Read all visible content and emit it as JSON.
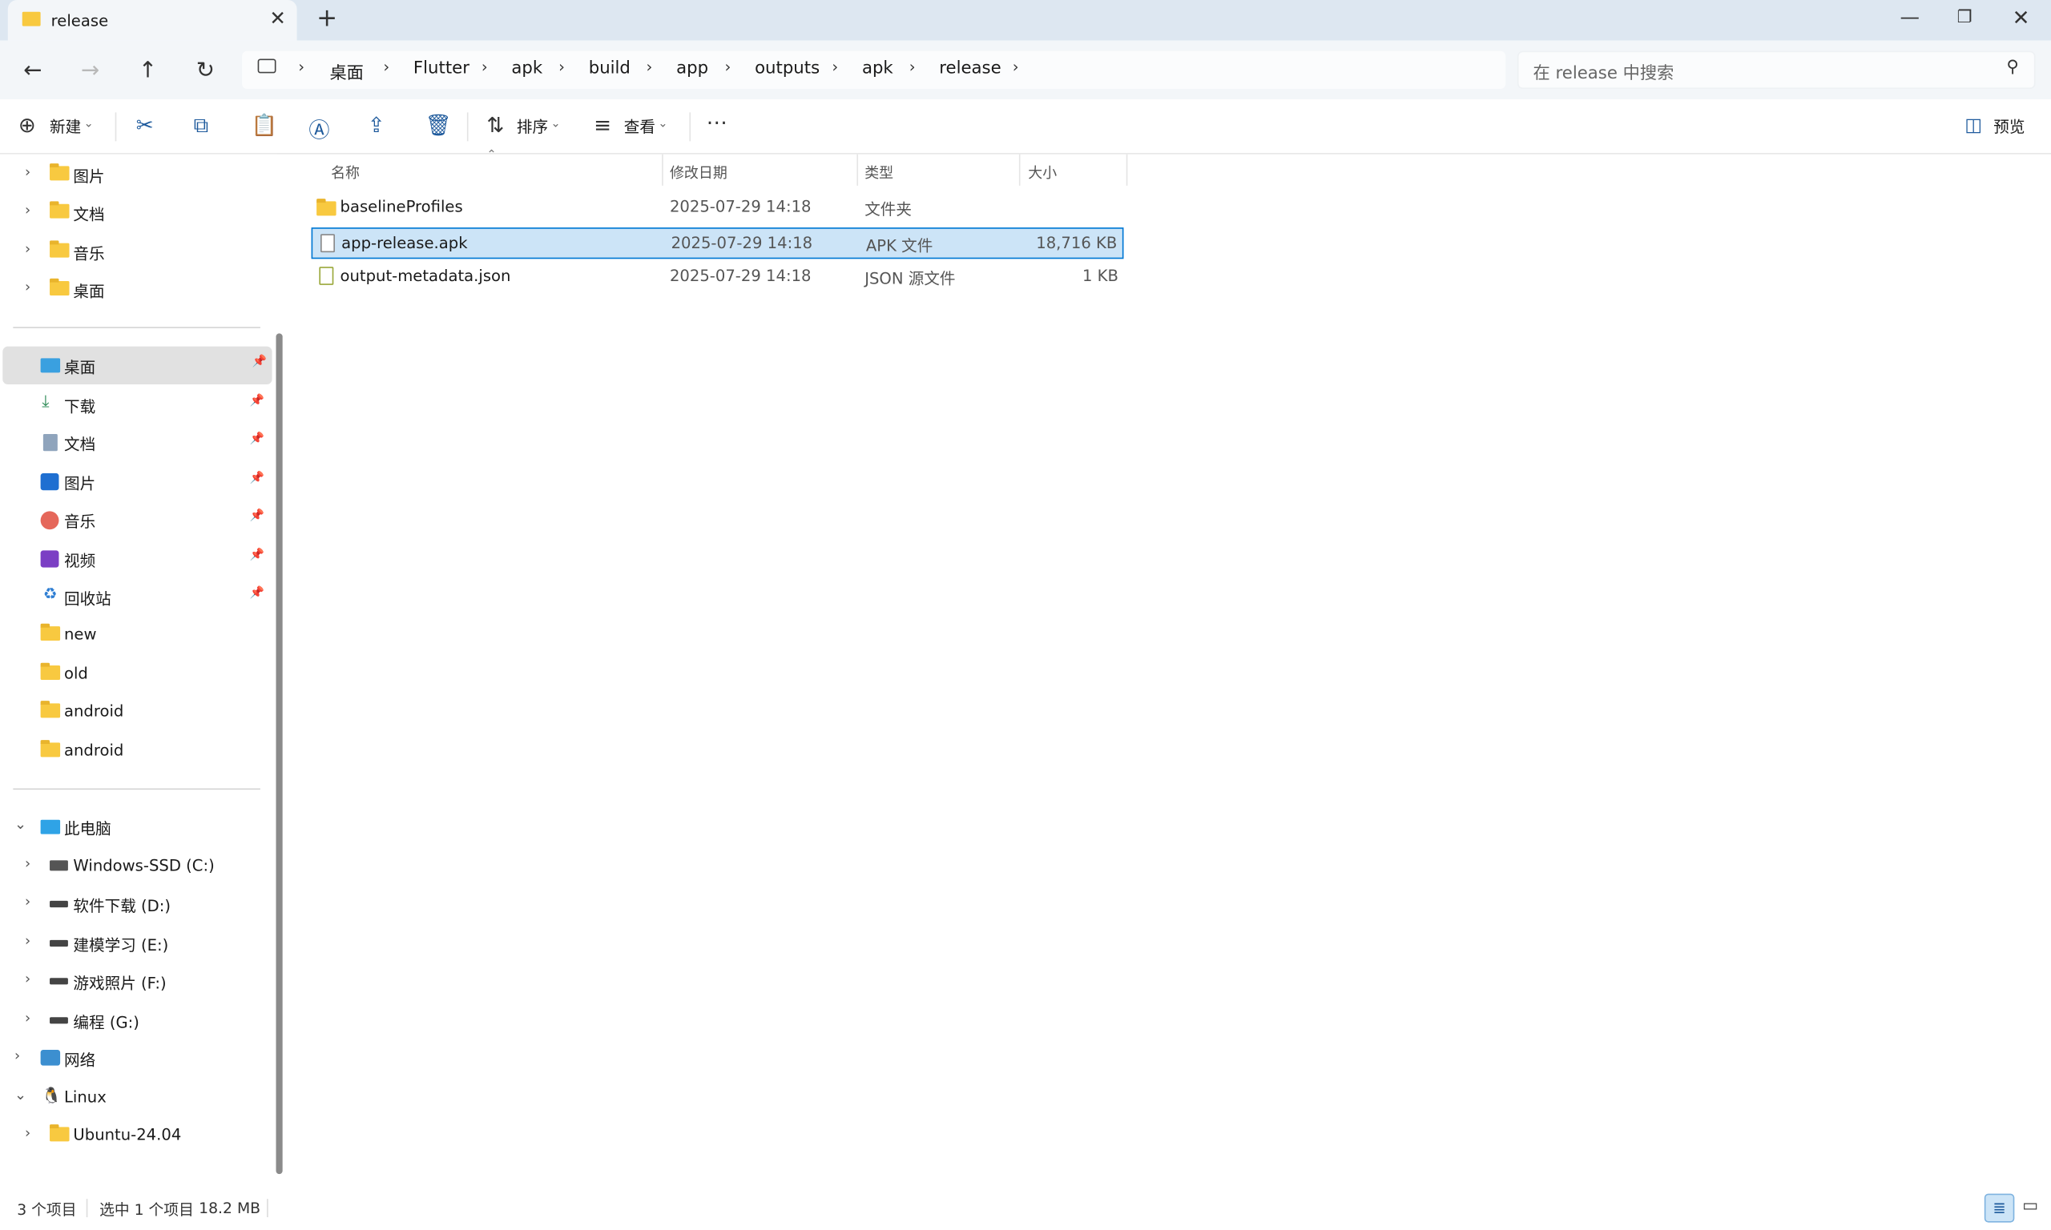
{
  "window": {
    "tab_title": "release"
  },
  "address": {
    "crumbs": [
      "桌面",
      "Flutter",
      "apk",
      "build",
      "app",
      "outputs",
      "apk",
      "release"
    ],
    "search_placeholder": "在 release 中搜索"
  },
  "toolbar": {
    "new_label": "新建",
    "sort_label": "排序",
    "view_label": "查看",
    "preview_label": "预览"
  },
  "sidebar": {
    "top": [
      {
        "label": "图片"
      },
      {
        "label": "文档"
      },
      {
        "label": "音乐"
      },
      {
        "label": "桌面"
      }
    ],
    "quick": [
      {
        "label": "桌面",
        "pinned": true,
        "selected": true
      },
      {
        "label": "下载",
        "pinned": true
      },
      {
        "label": "文档",
        "pinned": true
      },
      {
        "label": "图片",
        "pinned": true
      },
      {
        "label": "音乐",
        "pinned": true
      },
      {
        "label": "视频",
        "pinned": true
      },
      {
        "label": "回收站",
        "pinned": true
      },
      {
        "label": "new"
      },
      {
        "label": "old"
      },
      {
        "label": "android"
      },
      {
        "label": "android"
      }
    ],
    "this_pc": "此电脑",
    "drives": [
      "Windows-SSD (C:)",
      "软件下载 (D:)",
      "建模学习 (E:)",
      "游戏照片 (F:)",
      "编程 (G:)"
    ],
    "network": "网络",
    "linux": "Linux",
    "distro": "Ubuntu-24.04"
  },
  "columns": {
    "name": "名称",
    "date": "修改日期",
    "type": "类型",
    "size": "大小"
  },
  "files": [
    {
      "name": "baselineProfiles",
      "date": "2025-07-29 14:18",
      "type": "文件夹",
      "size": ""
    },
    {
      "name": "app-release.apk",
      "date": "2025-07-29 14:18",
      "type": "APK 文件",
      "size": "18,716 KB"
    },
    {
      "name": "output-metadata.json",
      "date": "2025-07-29 14:18",
      "type": "JSON 源文件",
      "size": "1 KB"
    }
  ],
  "status": {
    "count": "3 个项目",
    "selection": "选中 1 个项目",
    "size": "18.2 MB"
  },
  "colors": {
    "accent": "#0078d4",
    "selection": "#cce4f7",
    "titlebar": "#dde7f1",
    "folder": "#f8c940"
  }
}
